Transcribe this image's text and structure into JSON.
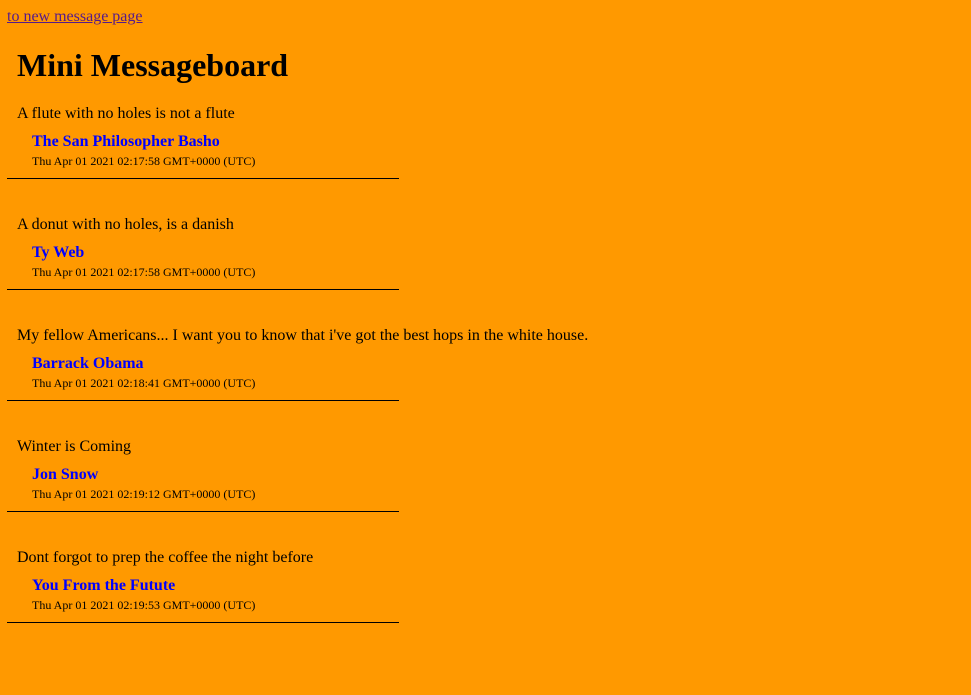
{
  "nav": {
    "new_message_link": "to new message page"
  },
  "header": {
    "title": "Mini Messageboard"
  },
  "messages": [
    {
      "text": "A flute with no holes is not a flute",
      "user": "The San Philosopher Basho",
      "added": "Thu Apr 01 2021 02:17:58 GMT+0000 (UTC)"
    },
    {
      "text": "A donut with no holes, is a danish",
      "user": "Ty Web",
      "added": "Thu Apr 01 2021 02:17:58 GMT+0000 (UTC)"
    },
    {
      "text": "My fellow Americans... I want you to know that i've got the best hops in the white house.",
      "user": "Barrack Obama",
      "added": "Thu Apr 01 2021 02:18:41 GMT+0000 (UTC)"
    },
    {
      "text": "Winter is Coming",
      "user": "Jon Snow",
      "added": "Thu Apr 01 2021 02:19:12 GMT+0000 (UTC)"
    },
    {
      "text": "Dont forgot to prep the coffee the night before",
      "user": "You From the Futute",
      "added": "Thu Apr 01 2021 02:19:53 GMT+0000 (UTC)"
    }
  ],
  "colors": {
    "background": "#ff9900",
    "author": "#0000ff",
    "visited_link": "#551a8b"
  }
}
